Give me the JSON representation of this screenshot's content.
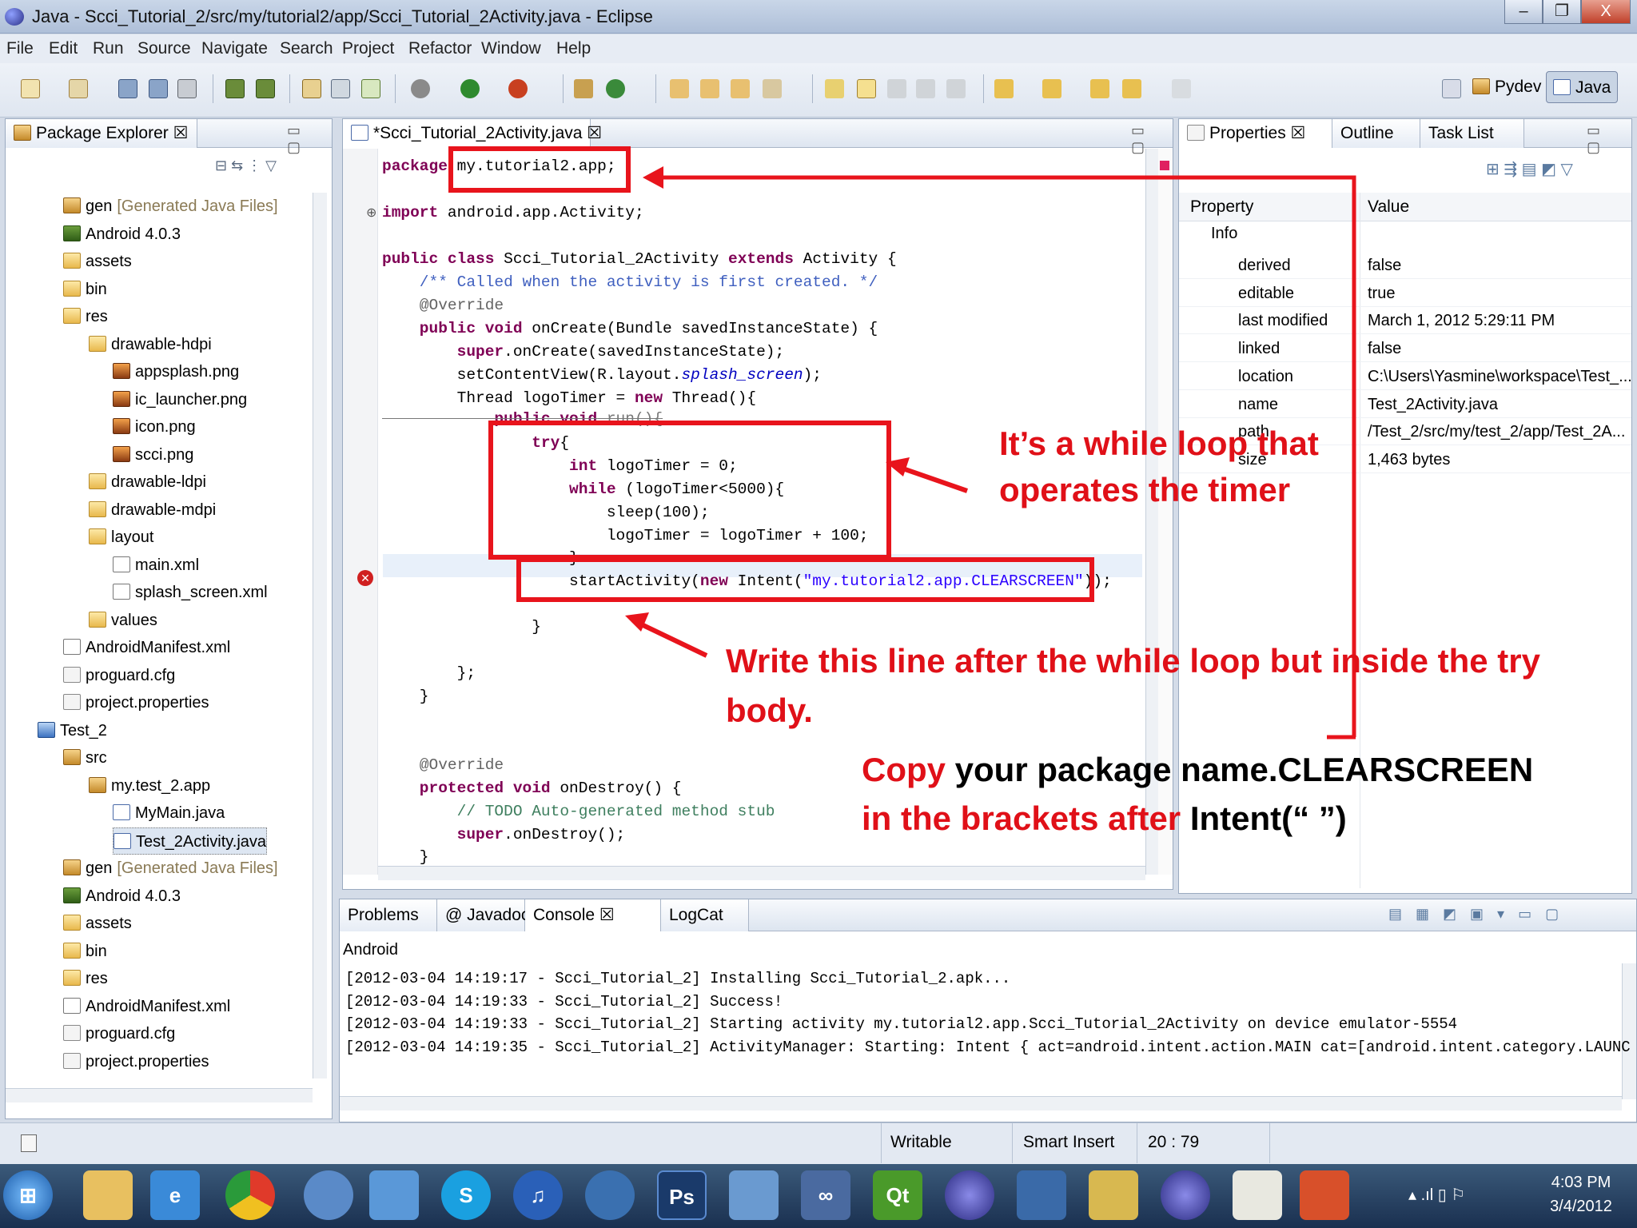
{
  "window": {
    "title": "Java - Scci_Tutorial_2/src/my/tutorial2/app/Scci_Tutorial_2Activity.java - Eclipse",
    "minimize": "–",
    "maximize": "❐",
    "close": "X"
  },
  "menu": [
    "File",
    "Edit",
    "Run",
    "Source",
    "Navigate",
    "Search",
    "Project",
    "Refactor",
    "Window",
    "Help"
  ],
  "perspectives": {
    "pydev": "Pydev",
    "java": "Java"
  },
  "package_explorer": {
    "tab": "Package Explorer",
    "items": [
      {
        "label": "gen",
        "suffix": "[Generated Java Files]",
        "icon": "package-folder-icon"
      },
      {
        "label": "Android 4.0.3",
        "suffix": "",
        "icon": "library-icon"
      },
      {
        "label": "assets",
        "suffix": "",
        "icon": "folder-icon"
      },
      {
        "label": "bin",
        "suffix": "",
        "icon": "folder-icon"
      },
      {
        "label": "res",
        "suffix": "",
        "icon": "folder-icon"
      },
      {
        "label": "drawable-hdpi",
        "suffix": "",
        "icon": "folder-open-icon"
      },
      {
        "label": "appsplash.png",
        "suffix": "",
        "icon": "png-file-icon"
      },
      {
        "label": "ic_launcher.png",
        "suffix": "",
        "icon": "png-file-icon"
      },
      {
        "label": "icon.png",
        "suffix": "",
        "icon": "png-file-icon"
      },
      {
        "label": "scci.png",
        "suffix": "",
        "icon": "png-file-icon"
      },
      {
        "label": "drawable-ldpi",
        "suffix": "",
        "icon": "folder-open-icon"
      },
      {
        "label": "drawable-mdpi",
        "suffix": "",
        "icon": "folder-open-icon"
      },
      {
        "label": "layout",
        "suffix": "",
        "icon": "folder-open-icon"
      },
      {
        "label": "main.xml",
        "suffix": "",
        "icon": "xml-file-icon"
      },
      {
        "label": "splash_screen.xml",
        "suffix": "",
        "icon": "xml-file-icon"
      },
      {
        "label": "values",
        "suffix": "",
        "icon": "folder-open-icon"
      },
      {
        "label": "AndroidManifest.xml",
        "suffix": "",
        "icon": "manifest-file-icon"
      },
      {
        "label": "proguard.cfg",
        "suffix": "",
        "icon": "text-file-icon"
      },
      {
        "label": "project.properties",
        "suffix": "",
        "icon": "text-file-icon"
      },
      {
        "label": "Test_2",
        "suffix": "",
        "icon": "project-icon"
      },
      {
        "label": "src",
        "suffix": "",
        "icon": "source-folder-icon"
      },
      {
        "label": "my.test_2.app",
        "suffix": "",
        "icon": "package-icon"
      },
      {
        "label": "MyMain.java",
        "suffix": "",
        "icon": "java-file-icon"
      },
      {
        "label": "Test_2Activity.java",
        "suffix": "",
        "icon": "java-file-icon"
      },
      {
        "label": "gen",
        "suffix": "[Generated Java Files]",
        "icon": "package-folder-icon"
      },
      {
        "label": "Android 4.0.3",
        "suffix": "",
        "icon": "library-icon"
      },
      {
        "label": "assets",
        "suffix": "",
        "icon": "folder-icon"
      },
      {
        "label": "bin",
        "suffix": "",
        "icon": "folder-icon"
      },
      {
        "label": "res",
        "suffix": "",
        "icon": "folder-icon"
      },
      {
        "label": "AndroidManifest.xml",
        "suffix": "",
        "icon": "manifest-file-icon"
      },
      {
        "label": "proguard.cfg",
        "suffix": "",
        "icon": "text-file-icon"
      },
      {
        "label": "project.properties",
        "suffix": "",
        "icon": "text-file-icon"
      }
    ]
  },
  "editor": {
    "tab": "*Scci_Tutorial_2Activity.java",
    "lines": {
      "l1_kw": "package",
      "l1_rest": " my.tutorial2.app;",
      "l2_kw": "import",
      "l2_rest": " android.app.Activity;",
      "l3_kw": "public class",
      "l3_mid": " Scci_Tutorial_2Activity ",
      "l3_kw2": "extends",
      "l3_rest": " Activity {",
      "l4": "    /** Called when the activity is first created. */",
      "l5": "    @Override",
      "l6_kw": "    public void",
      "l6_rest": " onCreate(Bundle savedInstanceState) {",
      "l7_kw": "        super",
      "l7_rest": ".onCreate(savedInstanceState);",
      "l8_a": "        setContentView(R.layout.",
      "l8_it": "splash_screen",
      "l8_b": ");",
      "l9_a": "        Thread logoTimer = ",
      "l9_kw": "new",
      "l9_b": " Thread(){",
      "l10_kw": "            public void",
      "l10_rest": " run(){",
      "l11_kw": "                try",
      "l11_rest": "{",
      "l12_kw": "                    int",
      "l12_rest": " logoTimer = 0;",
      "l13_kw": "                    while",
      "l13_rest": " (logoTimer<5000){",
      "l14": "                        sleep(100);",
      "l15": "                        logoTimer = logoTimer + 100;",
      "l16": "                    }",
      "l17_a": "                    startActivity(",
      "l17_kw": "new",
      "l17_b": " Intent(",
      "l17_st": "\"my.tutorial2.app.CLEARSCREEN\"",
      "l17_c": "));",
      "l18": "                }",
      "l19": "            }",
      "l20": "        };",
      "l21": "    }",
      "l22": "    @Override",
      "l23_kw": "    protected void",
      "l23_rest": " onDestroy() {",
      "l24": "        // TODO Auto-generated method stub",
      "l25_kw": "        super",
      "l25_rest": ".onDestroy();",
      "l26": "    }"
    }
  },
  "annotations": {
    "while_loop_1": "It’s a while loop that",
    "while_loop_2": "operates the timer",
    "write_line_1": "Write this line after the while loop but inside the try",
    "write_line_2": "body.",
    "copy_1_red": "Copy",
    "copy_1_black": " your package name.CLEARSCREEN",
    "copy_2_red": "in the brackets after",
    "copy_2_black": " Intent(“  ”)"
  },
  "properties": {
    "tabs": [
      "Properties",
      "Outline",
      "Task List"
    ],
    "col_property": "Property",
    "col_value": "Value",
    "group": "Info",
    "rows": [
      {
        "key": "derived",
        "value": "false"
      },
      {
        "key": "editable",
        "value": "true"
      },
      {
        "key": "last modified",
        "value": "March 1, 2012 5:29:11 PM"
      },
      {
        "key": "linked",
        "value": "false"
      },
      {
        "key": "location",
        "value": "C:\\Users\\Yasmine\\workspace\\Test_..."
      },
      {
        "key": "name",
        "value": "Test_2Activity.java"
      },
      {
        "key": "path",
        "value": "/Test_2/src/my/test_2/app/Test_2A..."
      },
      {
        "key": "size",
        "value": "1,463  bytes"
      }
    ]
  },
  "console": {
    "tabs": [
      "Problems",
      "Javadoc",
      "Console",
      "LogCat"
    ],
    "header": "Android",
    "lines": [
      "[2012-03-04 14:19:17 - Scci_Tutorial_2] Installing Scci_Tutorial_2.apk...",
      "[2012-03-04 14:19:33 - Scci_Tutorial_2] Success!",
      "[2012-03-04 14:19:33 - Scci_Tutorial_2] Starting activity my.tutorial2.app.Scci_Tutorial_2Activity on device emulator-5554",
      "[2012-03-04 14:19:35 - Scci_Tutorial_2] ActivityManager: Starting: Intent { act=android.intent.action.MAIN cat=[android.intent.category.LAUNC"
    ]
  },
  "status": {
    "writable": "Writable",
    "insert": "Smart Insert",
    "position": "20 : 79"
  },
  "taskbar": {
    "time": "4:03 PM",
    "date": "3/4/2012"
  },
  "colors": {
    "annotation_red": "#e8141c",
    "keyword": "#7f0055",
    "string": "#2a00ff",
    "comment": "#3f5fbf"
  }
}
